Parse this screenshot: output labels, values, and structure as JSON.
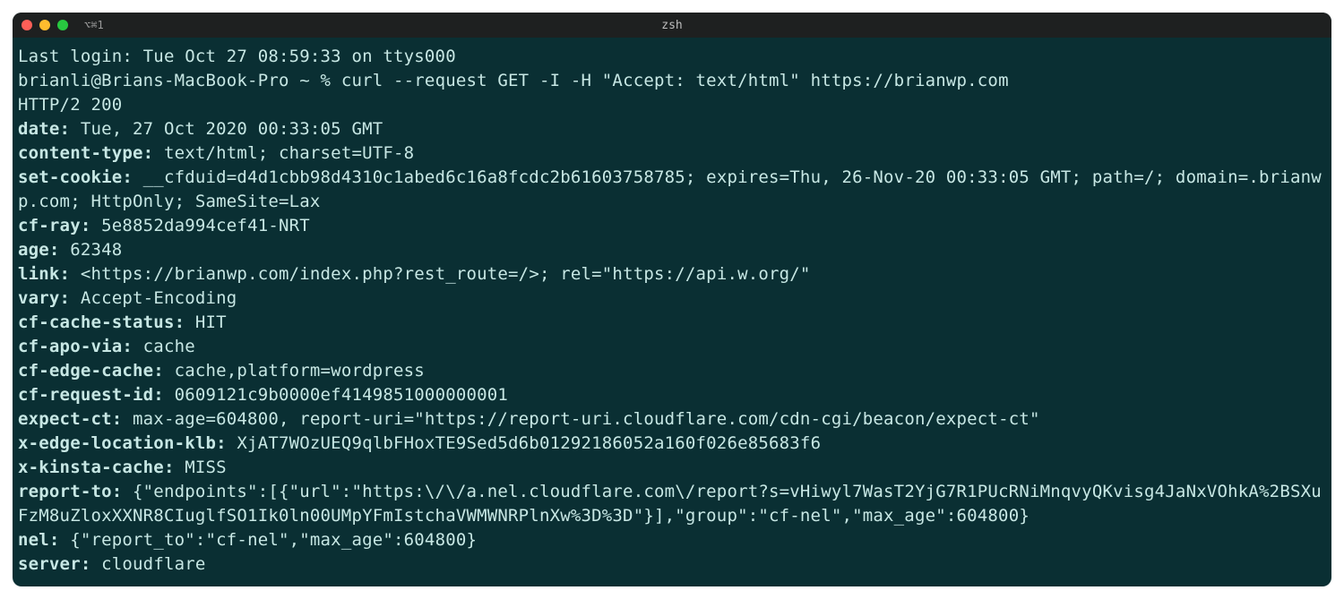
{
  "titlebar": {
    "tab_label": "⌥⌘1",
    "title": "zsh"
  },
  "terminal": {
    "last_login": "Last login: Tue Oct 27 08:59:33 on ttys000",
    "prompt": "brianli@Brians-MacBook-Pro ~ % ",
    "command": "curl --request GET -I -H \"Accept: text/html\" https://brianwp.com",
    "status_line": "HTTP/2 200",
    "headers": [
      {
        "k": "date:",
        "v": " Tue, 27 Oct 2020 00:33:05 GMT"
      },
      {
        "k": "content-type:",
        "v": " text/html; charset=UTF-8"
      },
      {
        "k": "set-cookie:",
        "v": " __cfduid=d4d1cbb98d4310c1abed6c16a8fcdc2b61603758785; expires=Thu, 26-Nov-20 00:33:05 GMT; path=/; domain=.brianwp.com; HttpOnly; SameSite=Lax"
      },
      {
        "k": "cf-ray:",
        "v": " 5e8852da994cef41-NRT"
      },
      {
        "k": "age:",
        "v": " 62348"
      },
      {
        "k": "link:",
        "v": " <https://brianwp.com/index.php?rest_route=/>; rel=\"https://api.w.org/\""
      },
      {
        "k": "vary:",
        "v": " Accept-Encoding"
      },
      {
        "k": "cf-cache-status:",
        "v": " HIT"
      },
      {
        "k": "cf-apo-via:",
        "v": " cache"
      },
      {
        "k": "cf-edge-cache:",
        "v": " cache,platform=wordpress"
      },
      {
        "k": "cf-request-id:",
        "v": " 0609121c9b0000ef4149851000000001"
      },
      {
        "k": "expect-ct:",
        "v": " max-age=604800, report-uri=\"https://report-uri.cloudflare.com/cdn-cgi/beacon/expect-ct\""
      },
      {
        "k": "x-edge-location-klb:",
        "v": " XjAT7WOzUEQ9qlbFHoxTE9Sed5d6b01292186052a160f026e85683f6"
      },
      {
        "k": "x-kinsta-cache:",
        "v": " MISS"
      },
      {
        "k": "report-to:",
        "v": " {\"endpoints\":[{\"url\":\"https:\\/\\/a.nel.cloudflare.com\\/report?s=vHiwyl7WasT2YjG7R1PUcRNiMnqvyQKvisg4JaNxVOhkA%2BSXuFzM8uZloxXXNR8CIuglfSO1Ik0ln00UMpYFmIstchaVWMWNRPlnXw%3D%3D\"}],\"group\":\"cf-nel\",\"max_age\":604800}"
      },
      {
        "k": "nel:",
        "v": " {\"report_to\":\"cf-nel\",\"max_age\":604800}"
      },
      {
        "k": "server:",
        "v": " cloudflare"
      }
    ]
  }
}
